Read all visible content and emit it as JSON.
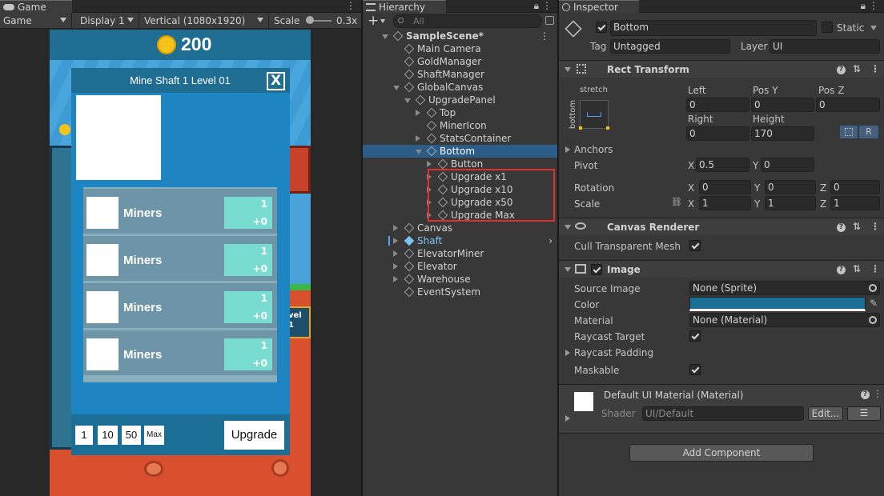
{
  "game": {
    "tab_label": "Game",
    "toolbar": {
      "mode": "Game",
      "display": "Display 1",
      "resolution": "Vertical (1080x1920)",
      "scale_label": "Scale",
      "scale_value": "0.3x"
    },
    "coins": "200",
    "panel": {
      "title": "Mine Shaft 1 Level 01",
      "close": "X",
      "rows": [
        {
          "name": "Miners",
          "stat_top": "1",
          "stat_bottom": "+0"
        },
        {
          "name": "Miners",
          "stat_top": "1",
          "stat_bottom": "+0"
        },
        {
          "name": "Miners",
          "stat_top": "1",
          "stat_bottom": "+0"
        },
        {
          "name": "Miners",
          "stat_top": "1",
          "stat_bottom": "+0"
        }
      ],
      "qty_buttons": [
        "1",
        "10",
        "50",
        "Max"
      ],
      "upgrade": "Upgrade",
      "level_tag_top": "vel",
      "level_tag_bottom": "1"
    }
  },
  "hierarchy": {
    "tab_label": "Hierarchy",
    "search_placeholder": "All",
    "add": "+",
    "items": [
      {
        "label": "SampleScene*",
        "depth": 0,
        "arrow": "open",
        "scene": true
      },
      {
        "label": "Main Camera",
        "depth": 1,
        "arrow": "none"
      },
      {
        "label": "GoldManager",
        "depth": 1,
        "arrow": "none"
      },
      {
        "label": "ShaftManager",
        "depth": 1,
        "arrow": "none"
      },
      {
        "label": "GlobalCanvas",
        "depth": 1,
        "arrow": "open"
      },
      {
        "label": "UpgradePanel",
        "depth": 2,
        "arrow": "open"
      },
      {
        "label": "Top",
        "depth": 3,
        "arrow": "closed"
      },
      {
        "label": "MinerIcon",
        "depth": 3,
        "arrow": "none"
      },
      {
        "label": "StatsContainer",
        "depth": 3,
        "arrow": "closed"
      },
      {
        "label": "Bottom",
        "depth": 3,
        "arrow": "open",
        "selected": true
      },
      {
        "label": "Button",
        "depth": 4,
        "arrow": "closed"
      },
      {
        "label": "Upgrade x1",
        "depth": 4,
        "arrow": "closed"
      },
      {
        "label": "Upgrade x10",
        "depth": 4,
        "arrow": "closed"
      },
      {
        "label": "Upgrade x50",
        "depth": 4,
        "arrow": "closed"
      },
      {
        "label": "Upgrade Max",
        "depth": 4,
        "arrow": "closed"
      },
      {
        "label": "Canvas",
        "depth": 1,
        "arrow": "closed"
      },
      {
        "label": "Shaft",
        "depth": 1,
        "arrow": "closed",
        "prefab": true
      },
      {
        "label": "ElevatorMiner",
        "depth": 1,
        "arrow": "closed"
      },
      {
        "label": "Elevator",
        "depth": 1,
        "arrow": "closed"
      },
      {
        "label": "Warehouse",
        "depth": 1,
        "arrow": "closed"
      },
      {
        "label": "EventSystem",
        "depth": 1,
        "arrow": "none"
      }
    ]
  },
  "inspector": {
    "tab_label": "Inspector",
    "object_name": "Bottom",
    "static_label": "Static",
    "tag_label": "Tag",
    "tag_value": "Untagged",
    "layer_label": "Layer",
    "layer_value": "UI",
    "rect_transform": {
      "title": "Rect Transform",
      "anchor_preset_h": "stretch",
      "anchor_preset_v": "bottom",
      "left_label": "Left",
      "left": "0",
      "posy_label": "Pos Y",
      "posy": "0",
      "posz_label": "Pos Z",
      "posz": "0",
      "right_label": "Right",
      "right": "0",
      "height_label": "Height",
      "height": "170",
      "r_button": "R",
      "anchors_label": "Anchors",
      "pivot_label": "Pivot",
      "pivot_x": "0.5",
      "pivot_y": "0",
      "rotation_label": "Rotation",
      "rot_x": "0",
      "rot_y": "0",
      "rot_z": "0",
      "scale_label": "Scale",
      "scale_x": "1",
      "scale_y": "1",
      "scale_z": "1",
      "x": "X",
      "y": "Y",
      "z": "Z"
    },
    "canvas_renderer": {
      "title": "Canvas Renderer",
      "cull_label": "Cull Transparent Mesh"
    },
    "image": {
      "title": "Image",
      "source_label": "Source Image",
      "source_value": "None (Sprite)",
      "color_label": "Color",
      "color_value": "#1b6f96",
      "material_label": "Material",
      "material_value": "None (Material)",
      "raycast_label": "Raycast Target",
      "raycast_padding_label": "Raycast Padding",
      "maskable_label": "Maskable"
    },
    "material": {
      "title": "Default UI Material (Material)",
      "shader_label": "Shader",
      "shader_value": "UI/Default",
      "edit": "Edit..."
    },
    "add_component": "Add Component"
  }
}
